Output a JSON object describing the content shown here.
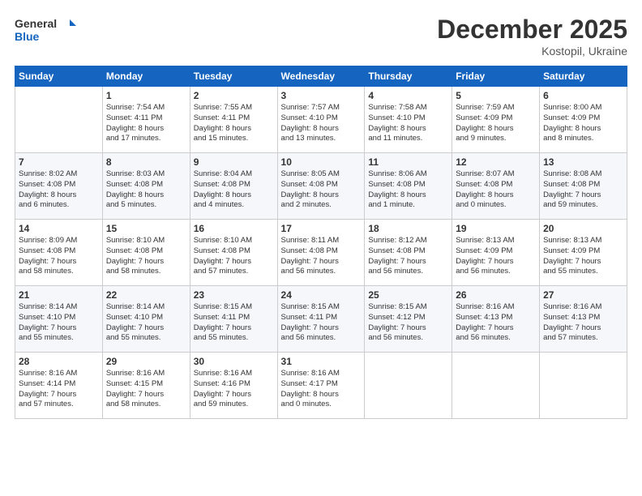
{
  "header": {
    "logo_line1": "General",
    "logo_line2": "Blue",
    "month": "December 2025",
    "location": "Kostopil, Ukraine"
  },
  "weekdays": [
    "Sunday",
    "Monday",
    "Tuesday",
    "Wednesday",
    "Thursday",
    "Friday",
    "Saturday"
  ],
  "weeks": [
    [
      {
        "day": "",
        "info": ""
      },
      {
        "day": "1",
        "info": "Sunrise: 7:54 AM\nSunset: 4:11 PM\nDaylight: 8 hours\nand 17 minutes."
      },
      {
        "day": "2",
        "info": "Sunrise: 7:55 AM\nSunset: 4:11 PM\nDaylight: 8 hours\nand 15 minutes."
      },
      {
        "day": "3",
        "info": "Sunrise: 7:57 AM\nSunset: 4:10 PM\nDaylight: 8 hours\nand 13 minutes."
      },
      {
        "day": "4",
        "info": "Sunrise: 7:58 AM\nSunset: 4:10 PM\nDaylight: 8 hours\nand 11 minutes."
      },
      {
        "day": "5",
        "info": "Sunrise: 7:59 AM\nSunset: 4:09 PM\nDaylight: 8 hours\nand 9 minutes."
      },
      {
        "day": "6",
        "info": "Sunrise: 8:00 AM\nSunset: 4:09 PM\nDaylight: 8 hours\nand 8 minutes."
      }
    ],
    [
      {
        "day": "7",
        "info": "Sunrise: 8:02 AM\nSunset: 4:08 PM\nDaylight: 8 hours\nand 6 minutes."
      },
      {
        "day": "8",
        "info": "Sunrise: 8:03 AM\nSunset: 4:08 PM\nDaylight: 8 hours\nand 5 minutes."
      },
      {
        "day": "9",
        "info": "Sunrise: 8:04 AM\nSunset: 4:08 PM\nDaylight: 8 hours\nand 4 minutes."
      },
      {
        "day": "10",
        "info": "Sunrise: 8:05 AM\nSunset: 4:08 PM\nDaylight: 8 hours\nand 2 minutes."
      },
      {
        "day": "11",
        "info": "Sunrise: 8:06 AM\nSunset: 4:08 PM\nDaylight: 8 hours\nand 1 minute."
      },
      {
        "day": "12",
        "info": "Sunrise: 8:07 AM\nSunset: 4:08 PM\nDaylight: 8 hours\nand 0 minutes."
      },
      {
        "day": "13",
        "info": "Sunrise: 8:08 AM\nSunset: 4:08 PM\nDaylight: 7 hours\nand 59 minutes."
      }
    ],
    [
      {
        "day": "14",
        "info": "Sunrise: 8:09 AM\nSunset: 4:08 PM\nDaylight: 7 hours\nand 58 minutes."
      },
      {
        "day": "15",
        "info": "Sunrise: 8:10 AM\nSunset: 4:08 PM\nDaylight: 7 hours\nand 58 minutes."
      },
      {
        "day": "16",
        "info": "Sunrise: 8:10 AM\nSunset: 4:08 PM\nDaylight: 7 hours\nand 57 minutes."
      },
      {
        "day": "17",
        "info": "Sunrise: 8:11 AM\nSunset: 4:08 PM\nDaylight: 7 hours\nand 56 minutes."
      },
      {
        "day": "18",
        "info": "Sunrise: 8:12 AM\nSunset: 4:08 PM\nDaylight: 7 hours\nand 56 minutes."
      },
      {
        "day": "19",
        "info": "Sunrise: 8:13 AM\nSunset: 4:09 PM\nDaylight: 7 hours\nand 56 minutes."
      },
      {
        "day": "20",
        "info": "Sunrise: 8:13 AM\nSunset: 4:09 PM\nDaylight: 7 hours\nand 55 minutes."
      }
    ],
    [
      {
        "day": "21",
        "info": "Sunrise: 8:14 AM\nSunset: 4:10 PM\nDaylight: 7 hours\nand 55 minutes."
      },
      {
        "day": "22",
        "info": "Sunrise: 8:14 AM\nSunset: 4:10 PM\nDaylight: 7 hours\nand 55 minutes."
      },
      {
        "day": "23",
        "info": "Sunrise: 8:15 AM\nSunset: 4:11 PM\nDaylight: 7 hours\nand 55 minutes."
      },
      {
        "day": "24",
        "info": "Sunrise: 8:15 AM\nSunset: 4:11 PM\nDaylight: 7 hours\nand 56 minutes."
      },
      {
        "day": "25",
        "info": "Sunrise: 8:15 AM\nSunset: 4:12 PM\nDaylight: 7 hours\nand 56 minutes."
      },
      {
        "day": "26",
        "info": "Sunrise: 8:16 AM\nSunset: 4:13 PM\nDaylight: 7 hours\nand 56 minutes."
      },
      {
        "day": "27",
        "info": "Sunrise: 8:16 AM\nSunset: 4:13 PM\nDaylight: 7 hours\nand 57 minutes."
      }
    ],
    [
      {
        "day": "28",
        "info": "Sunrise: 8:16 AM\nSunset: 4:14 PM\nDaylight: 7 hours\nand 57 minutes."
      },
      {
        "day": "29",
        "info": "Sunrise: 8:16 AM\nSunset: 4:15 PM\nDaylight: 7 hours\nand 58 minutes."
      },
      {
        "day": "30",
        "info": "Sunrise: 8:16 AM\nSunset: 4:16 PM\nDaylight: 7 hours\nand 59 minutes."
      },
      {
        "day": "31",
        "info": "Sunrise: 8:16 AM\nSunset: 4:17 PM\nDaylight: 8 hours\nand 0 minutes."
      },
      {
        "day": "",
        "info": ""
      },
      {
        "day": "",
        "info": ""
      },
      {
        "day": "",
        "info": ""
      }
    ]
  ]
}
